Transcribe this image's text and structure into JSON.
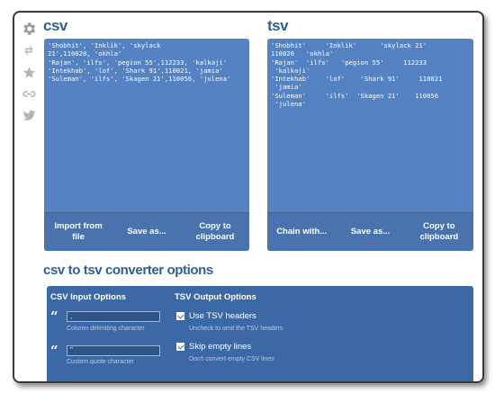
{
  "sidebar": {
    "icons": [
      "gear-icon",
      "swap-icon",
      "star-icon",
      "link-icon",
      "twitter-icon"
    ]
  },
  "csv_panel": {
    "title": "csv",
    "content": "'Shobhit', 'Inklik', 'skylack\n21',110020, 'okhla'\n'Rajan', 'ilfs', 'pegion 55',112233, 'kalkaji'\n'Intekhab', 'lof', 'Shark 91',110021, 'jamia'\n'Suleman', 'ilfs', 'Skagen 21',110056, 'julena'",
    "buttons": {
      "import": "Import from\nfile",
      "save": "Save as...",
      "copy": "Copy to\nclipboard"
    }
  },
  "tsv_panel": {
    "title": "tsv",
    "content": "'Shobhit'     'Inklik'      'skylack 21'\n110020   'okhla'\n'Rajan'  'ilfs'   'pegion 55'     112233\n 'kalkaji'\n'Intekhab'    'lof'    'Shark 91'     110021\n 'jamia'\n'Suleman'     'ilfs'  'Skagen 21'    110056\n 'julena'",
    "buttons": {
      "chain": "Chain with...",
      "save": "Save as...",
      "copy": "Copy to\nclipboard"
    }
  },
  "options": {
    "title": "csv to tsv converter options",
    "csv_input": {
      "heading": "CSV Input Options",
      "delimiter_value": ",",
      "delimiter_help": "Column delimiting character",
      "quote_value": "\"",
      "quote_help": "Custom quote character"
    },
    "tsv_output": {
      "heading": "TSV Output Options",
      "headers_label": "Use TSV headers",
      "headers_help": "Uncheck to omit the TSV headers",
      "skip_label": "Skip empty lines",
      "skip_help": "Don't convert empty CSV lines"
    }
  },
  "colors": {
    "accent": "#2f5f99",
    "panel": "#5582c2",
    "panel_bar": "#4a72ad",
    "options_panel": "#3d68a6"
  }
}
